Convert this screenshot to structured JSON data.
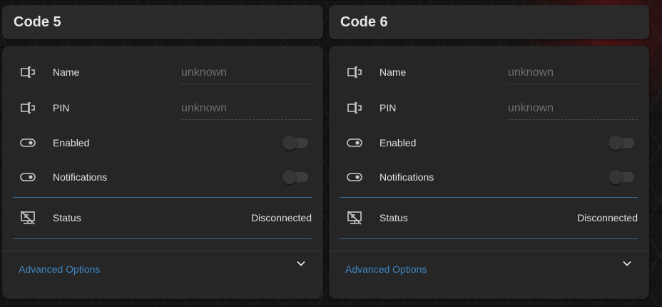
{
  "cards": [
    {
      "title": "Code 5",
      "name": {
        "label": "Name",
        "placeholder": "unknown",
        "icon": "textbox-icon"
      },
      "pin": {
        "label": "PIN",
        "placeholder": "unknown",
        "icon": "textbox-icon"
      },
      "enabled": {
        "label": "Enabled",
        "on": false,
        "icon": "toggle-icon"
      },
      "notifications": {
        "label": "Notifications",
        "on": false,
        "icon": "toggle-icon"
      },
      "status": {
        "label": "Status",
        "value": "Disconnected",
        "icon": "lan-disconnect-icon"
      },
      "advanced": {
        "label": "Advanced Options",
        "icon": "chevron-down-icon"
      }
    },
    {
      "title": "Code 6",
      "name": {
        "label": "Name",
        "placeholder": "unknown",
        "icon": "textbox-icon"
      },
      "pin": {
        "label": "PIN",
        "placeholder": "unknown",
        "icon": "textbox-icon"
      },
      "enabled": {
        "label": "Enabled",
        "on": false,
        "icon": "toggle-icon"
      },
      "notifications": {
        "label": "Notifications",
        "on": false,
        "icon": "toggle-icon"
      },
      "status": {
        "label": "Status",
        "value": "Disconnected",
        "icon": "lan-disconnect-icon"
      },
      "advanced": {
        "label": "Advanced Options",
        "icon": "chevron-down-icon"
      }
    }
  ],
  "colors": {
    "accent": "#3f88c5",
    "divider": "#3a6a92",
    "card": "#262626",
    "title_card": "#2a2a2a"
  }
}
